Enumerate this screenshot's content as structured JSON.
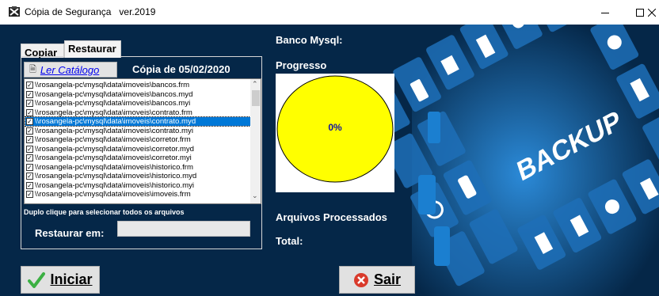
{
  "window": {
    "title": "Cópia de Segurança   ver.2019",
    "icon": "app-tools-icon",
    "controls": [
      "minimize-icon",
      "maximize-icon",
      "close-icon"
    ]
  },
  "tabs": [
    {
      "label": "Copiar",
      "active": false
    },
    {
      "label": "Restaurar",
      "active": true
    }
  ],
  "catalog": {
    "button_label": "Ler Catálogo",
    "button_icon": "catalog-icon",
    "copy_date": "Cópia de 05/02/2020"
  },
  "files": [
    {
      "path": "\\\\rosangela-pc\\mysql\\data\\imoveis\\bancos.frm",
      "checked": true,
      "selected": false
    },
    {
      "path": "\\\\rosangela-pc\\mysql\\data\\imoveis\\bancos.myd",
      "checked": true,
      "selected": false
    },
    {
      "path": "\\\\rosangela-pc\\mysql\\data\\imoveis\\bancos.myi",
      "checked": true,
      "selected": false
    },
    {
      "path": "\\\\rosangela-pc\\mysql\\data\\imoveis\\contrato.frm",
      "checked": true,
      "selected": false
    },
    {
      "path": "\\\\rosangela-pc\\mysql\\data\\imoveis\\contrato.myd",
      "checked": true,
      "selected": true
    },
    {
      "path": "\\\\rosangela-pc\\mysql\\data\\imoveis\\contrato.myi",
      "checked": true,
      "selected": false
    },
    {
      "path": "\\\\rosangela-pc\\mysql\\data\\imoveis\\corretor.frm",
      "checked": true,
      "selected": false
    },
    {
      "path": "\\\\rosangela-pc\\mysql\\data\\imoveis\\corretor.myd",
      "checked": true,
      "selected": false
    },
    {
      "path": "\\\\rosangela-pc\\mysql\\data\\imoveis\\corretor.myi",
      "checked": true,
      "selected": false
    },
    {
      "path": "\\\\rosangela-pc\\mysql\\data\\imoveis\\historico.frm",
      "checked": true,
      "selected": false
    },
    {
      "path": "\\\\rosangela-pc\\mysql\\data\\imoveis\\historico.myd",
      "checked": true,
      "selected": false
    },
    {
      "path": "\\\\rosangela-pc\\mysql\\data\\imoveis\\historico.myi",
      "checked": true,
      "selected": false
    },
    {
      "path": "\\\\rosangela-pc\\mysql\\data\\imoveis\\imoveis.frm",
      "checked": true,
      "selected": false
    }
  ],
  "hint": "Duplo clique para selecionar todos os arquivos",
  "restore": {
    "label": "Restaurar em:",
    "value": ""
  },
  "status": {
    "banco_label": "Banco Mysql:",
    "progress_label": "Progresso",
    "progress_percent_text": "0%",
    "progress_fraction": 0,
    "pie_color": "#ffff00",
    "processed_label": "Arquivos Processados",
    "total_label": "Total:"
  },
  "buttons": {
    "iniciar_label": "Iniciar",
    "iniciar_icon": "checkmark-icon",
    "sair_label": "Sair",
    "sair_icon": "exit-icon"
  },
  "background": {
    "caption": "BACKUP",
    "colors": {
      "navy": "#052748",
      "blue": "#1b7fd0",
      "light_blue": "#4ab0f0"
    }
  }
}
